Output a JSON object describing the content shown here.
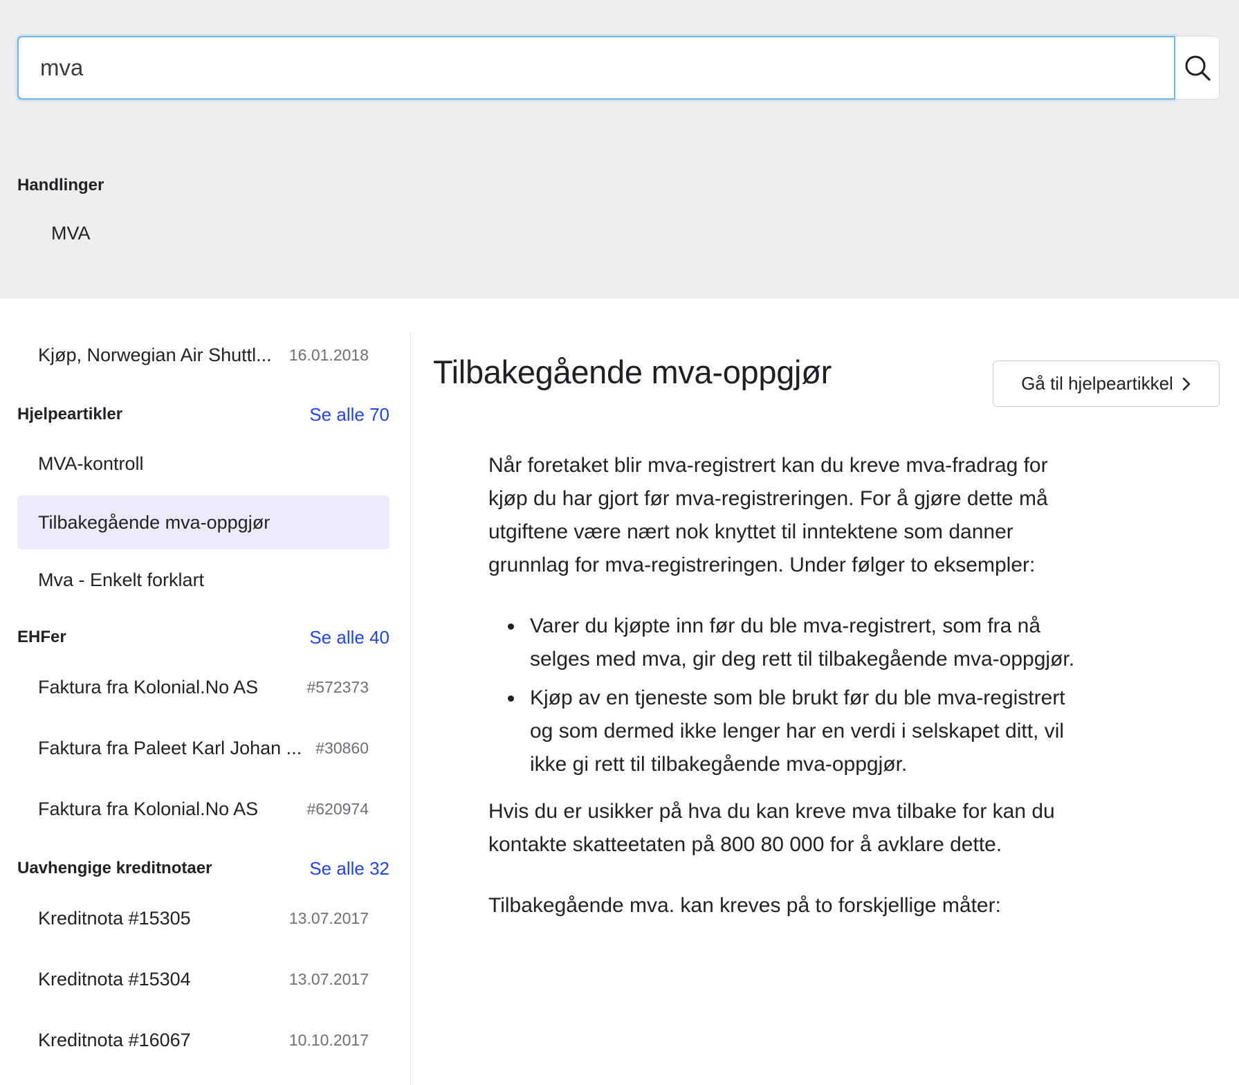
{
  "search": {
    "value": "mva",
    "button_icon": "search-icon"
  },
  "actions": {
    "heading": "Handlinger",
    "items": [
      {
        "label": "MVA"
      }
    ]
  },
  "results": {
    "top_item": {
      "title": "Kjøp, Norwegian Air Shuttl...",
      "meta": "16.01.2018"
    },
    "help_articles": {
      "heading": "Hjelpeartikler",
      "see_all": "Se alle 70",
      "items": [
        {
          "title": "MVA-kontroll"
        },
        {
          "title": "Tilbakegående mva-oppgjør",
          "selected": true
        },
        {
          "title": "Mva - Enkelt forklart"
        }
      ]
    },
    "ehf": {
      "heading": "EHFer",
      "see_all": "Se alle 40",
      "items": [
        {
          "title": "Faktura fra Kolonial.No AS",
          "meta": "#572373"
        },
        {
          "title": "Faktura fra Paleet Karl Johan ...",
          "meta": "#30860"
        },
        {
          "title": "Faktura fra Kolonial.No AS",
          "meta": "#620974"
        }
      ]
    },
    "credit_notes": {
      "heading": "Uavhengige kreditnotaer",
      "see_all": "Se alle 32",
      "items": [
        {
          "title": "Kreditnota #15305",
          "meta": "13.07.2017"
        },
        {
          "title": "Kreditnota #15304",
          "meta": "13.07.2017"
        },
        {
          "title": "Kreditnota #16067",
          "meta": "10.10.2017"
        }
      ]
    }
  },
  "article": {
    "title": "Tilbakegående mva-oppgjør",
    "help_button": "Gå til hjelpeartikkel",
    "help_button_icon": "chevron-right-icon",
    "paragraph_1": "Når foretaket blir mva-registrert kan du kreve mva-fradrag for kjøp du har gjort før mva-registreringen. For å gjøre dette må utgiftene være nært nok knyttet til inntektene som danner grunnlag for mva-registreringen. Under følger to eksempler:",
    "bullets": [
      "Varer du kjøpte inn før du ble mva-registrert, som fra nå selges med mva, gir deg rett til tilbakegående mva-oppgjør.",
      "Kjøp av en tjeneste som ble brukt før du ble mva-registrert og som dermed ikke lenger har en verdi i selskapet ditt, vil ikke gi rett til tilbakegående mva-oppgjør."
    ],
    "paragraph_2": "Hvis du er usikker på hva du kan kreve mva tilbake for kan du kontakte skatteetaten på 800 80 000 for å avklare dette.",
    "paragraph_3": "Tilbakegående mva. kan kreves på to forskjellige måter:"
  },
  "colors": {
    "link": "#1f44e0",
    "selected_bg": "#ebeaf8",
    "search_focus": "#6fb2ec",
    "top_bg": "#eeeeef"
  }
}
